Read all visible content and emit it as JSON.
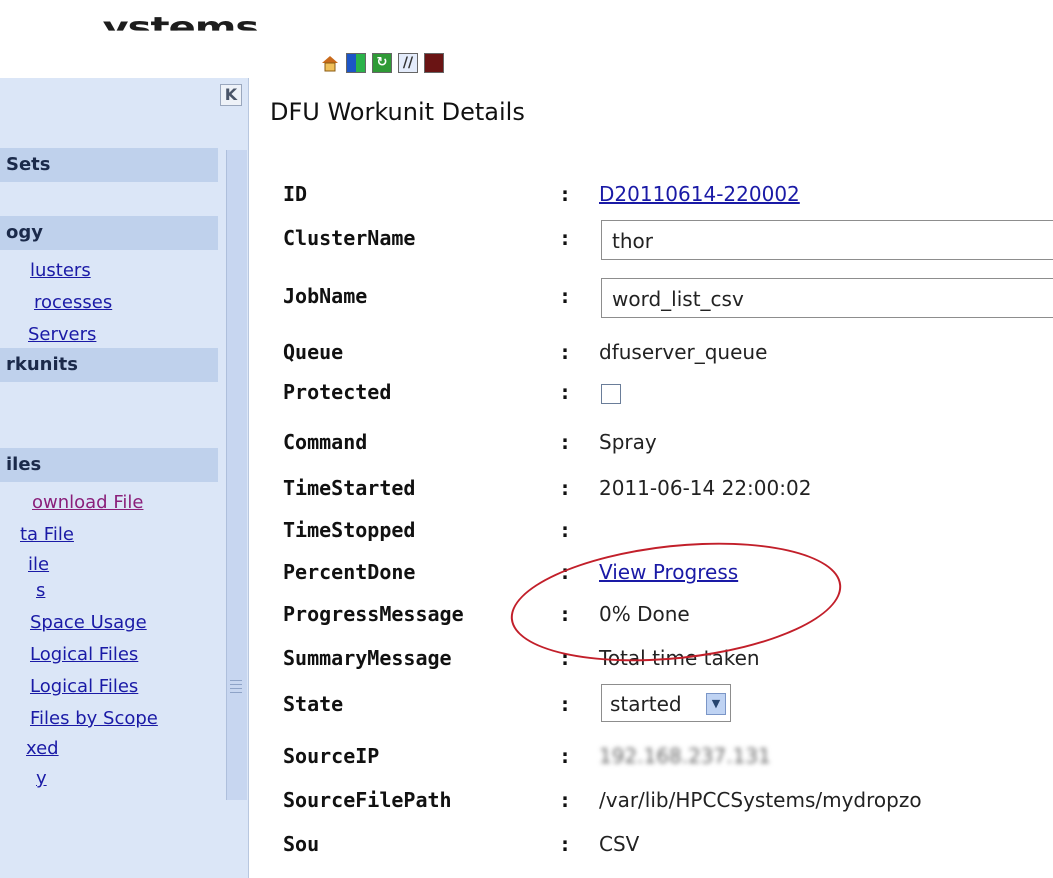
{
  "brand": "...ystems",
  "toolbar": {
    "icons": [
      "home-icon",
      "color-grid-icon",
      "refresh-icon",
      "slash-icon",
      "stop-icon"
    ]
  },
  "sidebar": {
    "collapse": "K",
    "sections": [
      {
        "label": "Sets"
      },
      {
        "label": "ogy"
      },
      {
        "label": "rkunits"
      },
      {
        "label": "iles"
      }
    ],
    "links": [
      {
        "label": "lusters"
      },
      {
        "label": "rocesses"
      },
      {
        "label": "Servers"
      },
      {
        "label": "ownload File"
      },
      {
        "label": "ta File"
      },
      {
        "label": "ile"
      },
      {
        "label": "s"
      },
      {
        "label": "Space Usage"
      },
      {
        "label": "Logical Files"
      },
      {
        "label": "Logical Files"
      },
      {
        "label": "Files by Scope"
      },
      {
        "label": "xed"
      },
      {
        "label": "y"
      }
    ]
  },
  "page_title": "DFU Workunit Details",
  "fields": [
    {
      "label": "ID",
      "value": "D20110614-220002"
    },
    {
      "label": "ClusterName",
      "value": "thor"
    },
    {
      "label": "JobName",
      "value": "word_list_csv"
    },
    {
      "label": "Queue",
      "value": "dfuserver_queue"
    },
    {
      "label": "Protected",
      "value": ""
    },
    {
      "label": "Command",
      "value": "Spray"
    },
    {
      "label": "TimeStarted",
      "value": "2011-06-14 22:00:02"
    },
    {
      "label": "TimeStopped",
      "value": ""
    },
    {
      "label": "PercentDone",
      "value": "View Progress"
    },
    {
      "label": "ProgressMessage",
      "value": "0% Done"
    },
    {
      "label": "SummaryMessage",
      "value": "Total time taken"
    },
    {
      "label": "State",
      "value": "started"
    },
    {
      "label": "SourceIP",
      "value": "192.168.237.131"
    },
    {
      "label": "SourceFilePath",
      "value": "/var/lib/HPCCSystems/mydropzo"
    },
    {
      "label": "Sou",
      "value": "CSV"
    }
  ],
  "colon": ":",
  "colors": {
    "highlight": "#c21f2a",
    "link": "#1a1aa6",
    "sidebar": "#dbe6f7"
  }
}
